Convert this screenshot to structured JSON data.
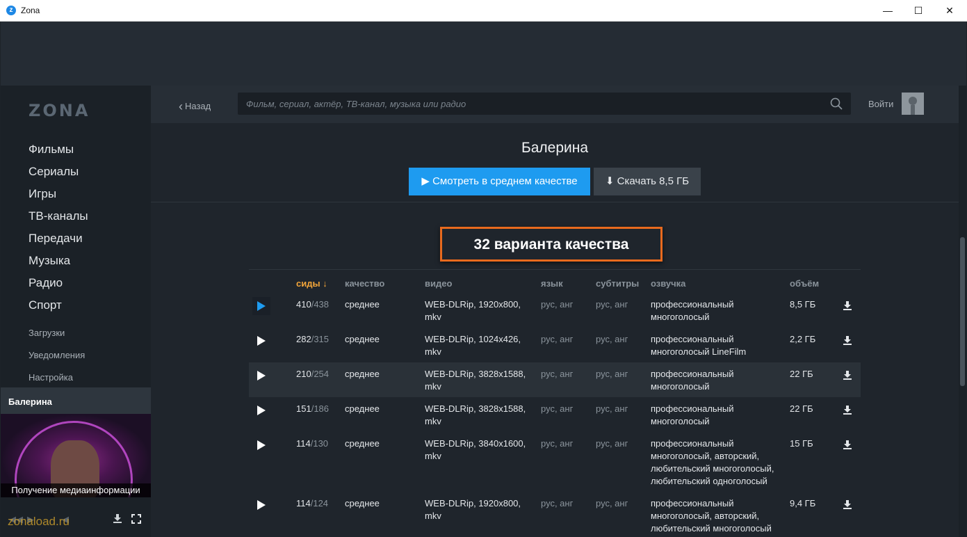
{
  "window": {
    "title": "Zona",
    "icon_letter": "z",
    "minimize": "—",
    "maximize": "☐",
    "close": "✕"
  },
  "sidebar": {
    "logo": "ZONA",
    "main_items": [
      "Фильмы",
      "Сериалы",
      "Игры",
      "ТВ-каналы",
      "Передачи",
      "Музыка",
      "Радио",
      "Спорт"
    ],
    "sub_items": [
      "Загрузки",
      "Уведомления",
      "Настройка"
    ],
    "now_playing": {
      "title": "Балерина",
      "caption": "Получение медиаинформации"
    },
    "watermark": "zonaload.ru"
  },
  "header": {
    "back": "Назад",
    "search_placeholder": "Фильм, сериал, актёр, ТВ-канал, музыка или радио",
    "login": "Войти"
  },
  "movie": {
    "title": "Балерина",
    "watch_label": "Смотреть в среднем качестве",
    "download_label": "Скачать 8,5 ГБ"
  },
  "variants_label": "32 варианта качества",
  "table": {
    "columns": [
      "сиды ↓",
      "качество",
      "видео",
      "язык",
      "субтитры",
      "озвучка",
      "объём"
    ],
    "rows": [
      {
        "seeds": "410",
        "peers": "/438",
        "quality": "среднее",
        "video": "WEB-DLRip, 1920x800, mkv",
        "lang": "рус, анг",
        "subs": "рус, анг",
        "voice": "профессиональный многоголосый",
        "size": "8,5 ГБ"
      },
      {
        "seeds": "282",
        "peers": "/315",
        "quality": "среднее",
        "video": "WEB-DLRip, 1024x426, mkv",
        "lang": "рус, анг",
        "subs": "рус, анг",
        "voice": "профессиональный многоголосый LineFilm",
        "size": "2,2 ГБ"
      },
      {
        "seeds": "210",
        "peers": "/254",
        "quality": "среднее",
        "video": "WEB-DLRip, 3828x1588, mkv",
        "lang": "рус, анг",
        "subs": "рус, анг",
        "voice": "профессиональный многоголосый",
        "size": "22 ГБ"
      },
      {
        "seeds": "151",
        "peers": "/186",
        "quality": "среднее",
        "video": "WEB-DLRip, 3828x1588, mkv",
        "lang": "рус, анг",
        "subs": "рус, анг",
        "voice": "профессиональный многоголосый",
        "size": "22 ГБ"
      },
      {
        "seeds": "114",
        "peers": "/130",
        "quality": "среднее",
        "video": "WEB-DLRip, 3840x1600, mkv",
        "lang": "рус, анг",
        "subs": "рус, анг",
        "voice": "профессиональный многоголосый, авторский, любительский многоголосый, любительский одноголосый",
        "size": "15 ГБ"
      },
      {
        "seeds": "114",
        "peers": "/124",
        "quality": "среднее",
        "video": "WEB-DLRip, 1920x800, mkv",
        "lang": "рус, анг",
        "subs": "рус, анг",
        "voice": "профессиональный многоголосый, авторский, любительский многоголосый",
        "size": "9,4 ГБ"
      }
    ]
  },
  "colors": {
    "accent": "#1e9bf0",
    "highlight": "#e86a1e",
    "sort_active": "#f2a53a"
  }
}
